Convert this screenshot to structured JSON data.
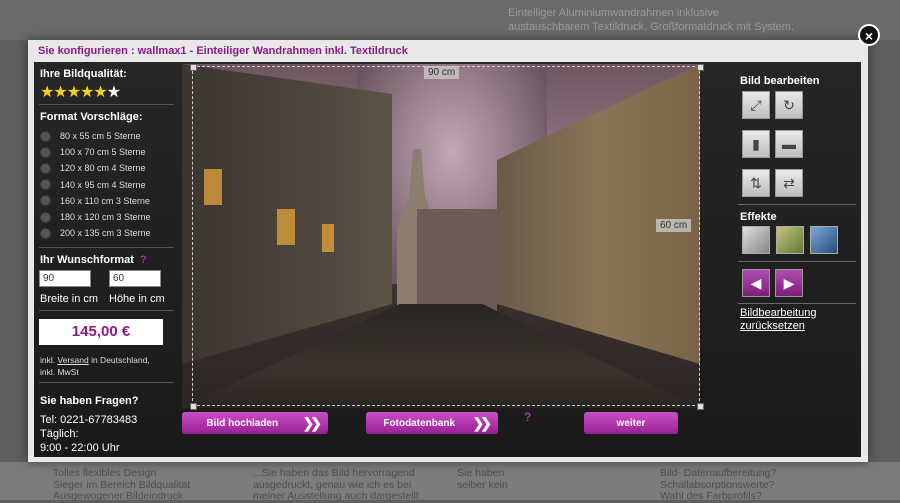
{
  "background": {
    "top_text_line1": "Einteiliger Aluminiumwandrahmen inklusive",
    "top_text_line2": "austauschbarem Textildruck. Großformatdruck mit System.",
    "bottom_col1": "Tolles flexibles Design\nSieger im Bereich Bildqualität\nAusgewogener Bildeindruck",
    "bottom_col2": "...Sie haben das Bild hervorragend\nausgedruckt, genau wie ich es bei\nmeiner Ausstellung auch dargestellt",
    "bottom_col3": "Sie haben\nselber kein",
    "bottom_col4": "Bild- Datenaufbereitung?\nSchallabsorptionswerte?\nWahl des Farbprofils?"
  },
  "modal": {
    "title": "Sie konfigurieren : wallmax1 - Einteiliger Wandrahmen inkl. Textildruck",
    "close_label": "×"
  },
  "left": {
    "quality_title": "Ihre Bildqualität:",
    "stars_filled": 5,
    "stars_total": 6,
    "format_title": "Format Vorschläge:",
    "formats": [
      "80 x 55 cm 5 Sterne",
      "100 x 70 cm 5 Sterne",
      "120 x 80 cm 4 Sterne",
      "140 x 95 cm 4 Sterne",
      "160 x 110 cm 3 Sterne",
      "180 x 120 cm 3 Sterne",
      "200 x 135 cm 3 Sterne"
    ],
    "wish_title": "Ihr Wunschformat",
    "wish_help": "?",
    "width_value": "90",
    "height_value": "60",
    "width_label": "Breite in cm",
    "height_label": "Höhe in cm",
    "price": "145,00 €",
    "shipping_prefix": "inkl.",
    "shipping_link": "Versand",
    "shipping_suffix": "in Deutschland,",
    "vat": "inkl. MwSt",
    "questions_title": "Sie haben Fragen?",
    "phone": "Tel: 0221-67783483",
    "daily": "Täglich:",
    "hours": "9:00 - 22:00 Uhr"
  },
  "image": {
    "width_label": "90 cm",
    "height_label": "60 cm"
  },
  "buttons": {
    "upload": "Bild hochladen",
    "stock": "Fotodatenbank",
    "help": "?",
    "next": "weiter"
  },
  "right": {
    "edit_title": "Bild bearbeiten",
    "effects_title": "Effekte",
    "reset_line1": "Bildbearbeitung",
    "reset_line2": "zurücksetzen"
  },
  "colors": {
    "accent": "#8b1a87",
    "button": "#b03aab",
    "star": "#f4d21a"
  }
}
